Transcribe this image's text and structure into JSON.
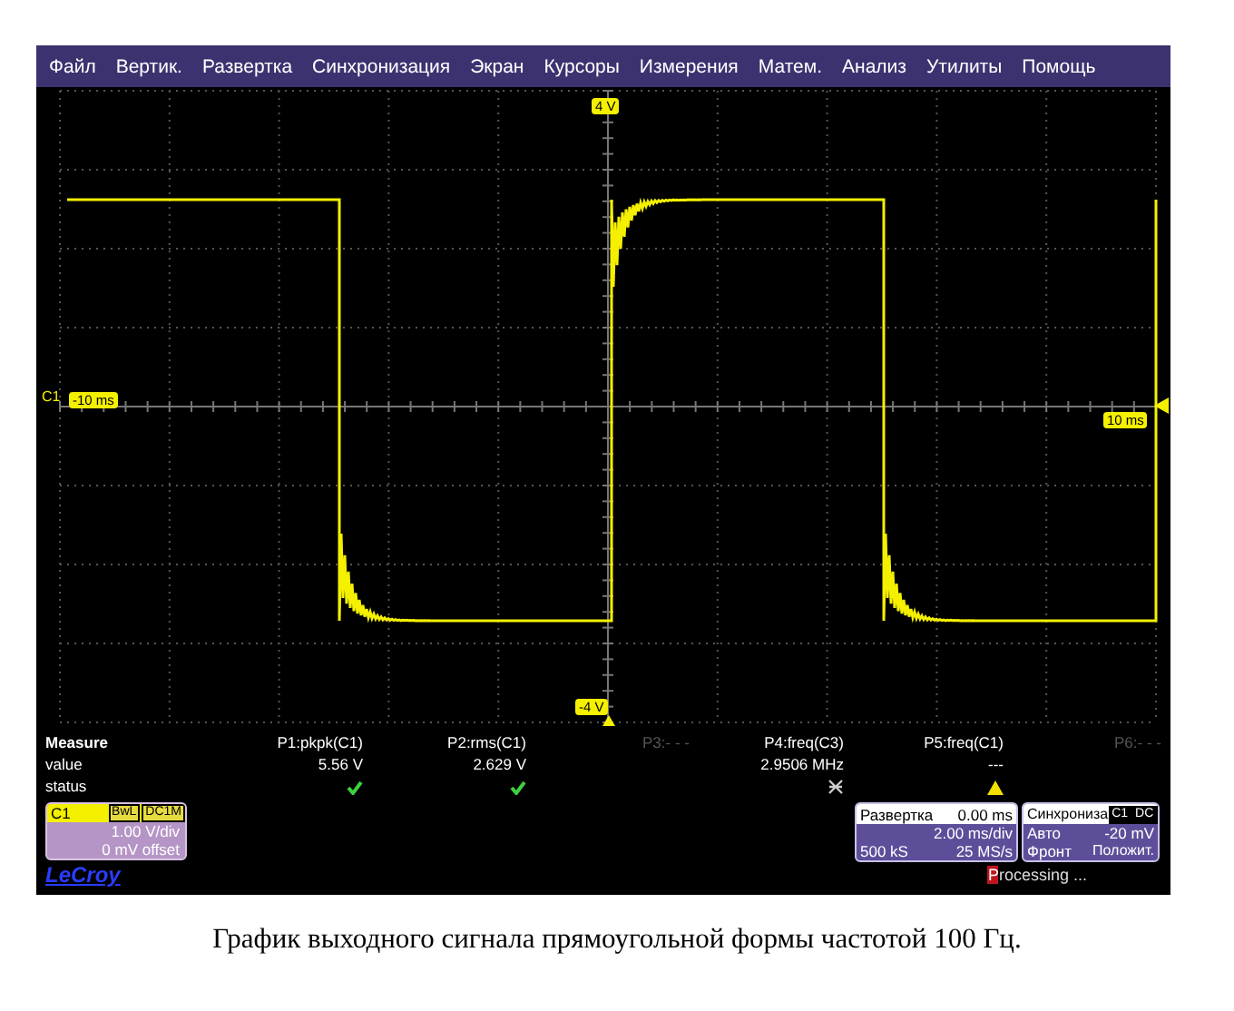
{
  "menu": [
    "Файл",
    "Вертик.",
    "Развертка",
    "Синхронизация",
    "Экран",
    "Курсоры",
    "Измерения",
    "Матем.",
    "Анализ",
    "Утилиты",
    "Помощь"
  ],
  "display": {
    "top_label": "4 V",
    "bottom_label": "-4 V",
    "channel_label": "C1",
    "left_time": "-10 ms",
    "right_time": "10 ms"
  },
  "measure": {
    "title": "Measure",
    "row_labels": [
      "value",
      "status"
    ],
    "params": [
      {
        "name": "P1:pkpk(C1)",
        "active": true,
        "value": "5.56 V",
        "kind": "ok"
      },
      {
        "name": "P2:rms(C1)",
        "active": true,
        "value": "2.629 V",
        "kind": "ok"
      },
      {
        "name": "P3:- - -",
        "active": false
      },
      {
        "name": "P4:freq(C3)",
        "active": true,
        "value": "2.9506 MHz",
        "kind": "invalid"
      },
      {
        "name": "P5:freq(C1)",
        "active": true,
        "value": "---",
        "kind": "warning"
      },
      {
        "name": "P6:- - -",
        "active": false
      }
    ]
  },
  "channel": {
    "name": "C1",
    "tags": [
      "BwL",
      "DC1M"
    ],
    "scale": "1.00 V/div",
    "offset": "0 mV offset"
  },
  "brand": "LeCroy",
  "timebase": {
    "title": "Развертка",
    "delay": "0.00 ms",
    "scale": "2.00 ms/div",
    "samples": "500 kS",
    "rate": "25 MS/s"
  },
  "trigger": {
    "title": "Синхрониза",
    "tags": [
      "C1",
      "DC"
    ],
    "mode": "Авто",
    "level": "-20 mV",
    "slope_label": "Фронт",
    "slope": "Положит."
  },
  "status": "Processing ...",
  "caption": "График выходного сигнала прямоугольной формы частотой 100 Гц."
}
